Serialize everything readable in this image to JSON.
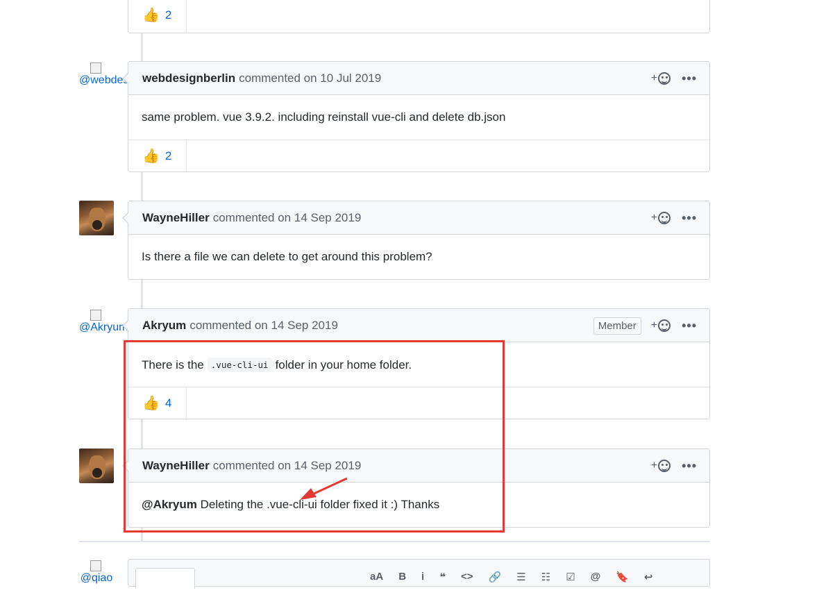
{
  "comments": [
    {
      "reaction_count": "2"
    },
    {
      "author": "webdesignberlin",
      "meta": "commented on 10 Jul 2019",
      "avatar_alt": "@webdesign",
      "body": "same problem. vue 3.9.2. including reinstall vue-cli and delete db.json",
      "reaction_count": "2"
    },
    {
      "author": "WayneHiller",
      "meta": "commented on 14 Sep 2019",
      "body": "Is there a file we can delete to get around this problem?"
    },
    {
      "author": "Akryum",
      "meta": "commented on 14 Sep 2019",
      "avatar_alt": "@Akryum",
      "badge": "Member",
      "body_before": "There is the",
      "body_code": ".vue-cli-ui",
      "body_after": "folder in your home folder.",
      "reaction_count": "4"
    },
    {
      "author": "WayneHiller",
      "meta": "commented on 14 Sep 2019",
      "mention": "@Akryum",
      "body": "Deleting the .vue-cli-ui folder fixed it :) Thanks"
    }
  ],
  "new_comment": {
    "avatar_alt": "@qiao"
  },
  "toolbar": [
    "aA",
    "B",
    "i",
    "❝",
    "<>",
    "🔗",
    "☰",
    "☷",
    "☑",
    "@",
    "🔖",
    "↩"
  ],
  "icons": {
    "thumbs_up": "👍",
    "add_reaction": "+",
    "more": "•••"
  },
  "colors": {
    "annotation_red": "#e53935",
    "link_blue": "#0366d6",
    "header_bg": "#f6f8fa"
  }
}
